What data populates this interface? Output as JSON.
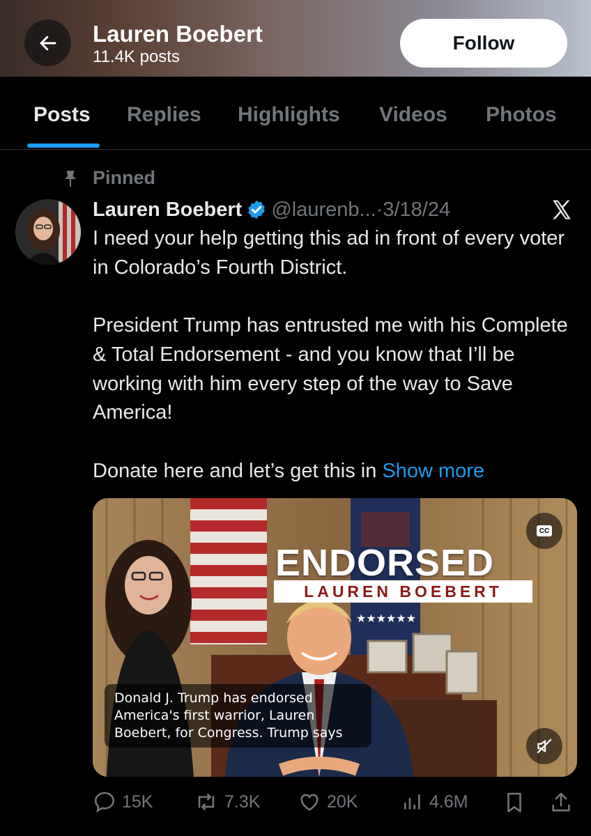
{
  "header": {
    "profile_name": "Lauren Boebert",
    "post_count": "11.4K posts",
    "follow_label": "Follow"
  },
  "tabs": [
    {
      "label": "Posts",
      "active": true
    },
    {
      "label": "Replies",
      "active": false
    },
    {
      "label": "Highlights",
      "active": false
    },
    {
      "label": "Videos",
      "active": false
    },
    {
      "label": "Photos",
      "active": false
    }
  ],
  "tweet": {
    "pinned_label": "Pinned",
    "author_name": "Lauren Boebert",
    "handle": "@laurenb...",
    "dot": "·",
    "date": "3/18/24",
    "text": "I need your help getting this ad in front of every voter in Colorado’s Fourth District.\n\nPresident Trump has entrusted me with his Complete & Total Endorsement - and you know that I’ll be working with him every step of the way to Save America!\n\nDonate here and let’s get this in ",
    "show_more": "Show more",
    "media": {
      "headline": "ENDORSED",
      "subheadline": "LAUREN BOEBERT",
      "cc_label": "CC",
      "caption": "Donald J. Trump has endorsed America's first warrior, Lauren Boebert, for Congress. Trump says"
    },
    "stats": {
      "replies": "15K",
      "reposts": "7.3K",
      "likes": "20K",
      "views": "4.6M"
    }
  },
  "colors": {
    "accent": "#1d9bf0",
    "muted": "#71767b",
    "text": "#e7e9ea",
    "background": "#000000"
  },
  "icons": [
    "back-arrow-icon",
    "pin-icon",
    "verified-badge-icon",
    "x-logo-icon",
    "cc-icon",
    "muted-speaker-icon",
    "reply-icon",
    "repost-icon",
    "like-icon",
    "views-icon",
    "bookmark-icon",
    "share-icon"
  ]
}
